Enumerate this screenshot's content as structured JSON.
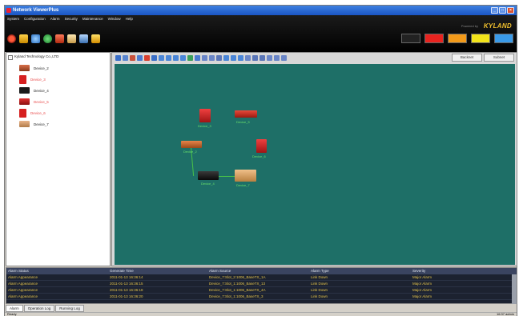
{
  "window": {
    "title": "Network ViewerPlus"
  },
  "menu": [
    "System",
    "Configuration",
    "Alarm",
    "Security",
    "Maintenance",
    "Window",
    "Help"
  ],
  "brand": {
    "prefix": "Powered by",
    "name": "KYLAND"
  },
  "colors": {
    "topology_bg": "#1e6f67",
    "link": "#48c248",
    "alarm_text": "#e3c24a"
  },
  "toolbar_icons": [
    "alarm-icon",
    "lock-icon",
    "network-icon",
    "globe-icon",
    "device-icon",
    "report-icon",
    "tool-icon",
    "user-icon"
  ],
  "alarm_buttons": [
    "Critical",
    "Major",
    "Minor",
    "Warning",
    "Info"
  ],
  "view_tabs": [
    "Backnet",
    "Subnet"
  ],
  "tree": {
    "root": "Kyland Technology Co.,LTD",
    "items": [
      {
        "label": "Device_2",
        "state": "normal",
        "icon": "switch-icon"
      },
      {
        "label": "Device_3",
        "state": "alarm",
        "icon": "switch-icon"
      },
      {
        "label": "Device_4",
        "state": "normal",
        "icon": "switch-icon"
      },
      {
        "label": "Device_5",
        "state": "alarm",
        "icon": "switch-icon"
      },
      {
        "label": "Device_6",
        "state": "alarm",
        "icon": "switch-icon"
      },
      {
        "label": "Device_7",
        "state": "normal",
        "icon": "switch-icon"
      }
    ]
  },
  "topology": {
    "nodes": [
      {
        "label": "Device_3",
        "kind": "red-tower"
      },
      {
        "label": "Device_5",
        "kind": "red-rack"
      },
      {
        "label": "Device_6",
        "kind": "red-tower"
      },
      {
        "label": "Device_2",
        "kind": "orange-rack"
      },
      {
        "label": "Device_4",
        "kind": "black-rack"
      },
      {
        "label": "Device_7",
        "kind": "tan-box"
      }
    ]
  },
  "alarm_table": {
    "headers": [
      "Alarm Status",
      "Generate Time",
      "Alarm Source",
      "Alarm Type",
      "Severity"
    ],
    "rows": [
      [
        "Alarm Appearance",
        "2011-01-13 16:36:14",
        "Device_7:Slot_2:1006_BaseTX_1A",
        "Link Down",
        "Major Alarm"
      ],
      [
        "Alarm Appearance",
        "2011-01-13 16:36:15",
        "Device_7:Slot_1:1006_BaseTX_13",
        "Link Down",
        "Major Alarm"
      ],
      [
        "Alarm Appearance",
        "2011-01-13 16:36:18",
        "Device_7:Slot_1:1006_BaseTX_4A",
        "Link Down",
        "Major Alarm"
      ],
      [
        "Alarm Appearance",
        "2011-01-13 16:36:20",
        "Device_7:Slot_1:1006_BaseTX_3",
        "Link Down",
        "Major Alarm"
      ]
    ]
  },
  "bottom_tabs": [
    "Alarm",
    "Operation Log",
    "Running Log"
  ],
  "status": {
    "left": "Ready",
    "right": "16:37 admin"
  }
}
